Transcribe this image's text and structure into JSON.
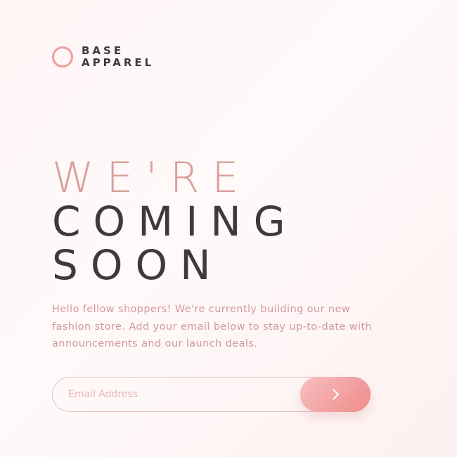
{
  "logo": {
    "line1": "BASE",
    "line2": "APPAREL",
    "mark_icon": "circle-ring-icon"
  },
  "headline": {
    "line1": "WE'RE",
    "line2": "COMING",
    "line3": "SOON"
  },
  "description": "Hello fellow shoppers! We're currently building our new fashion store. Add your email below to stay up-to-date with announcements and our launch deals.",
  "form": {
    "email_placeholder": "Email Address",
    "email_value": "",
    "submit_icon": "chevron-right-icon"
  },
  "colors": {
    "accent": "#f19c9c",
    "headline_light": "#d89b95",
    "headline_dark": "#3f3a3a",
    "body_text": "#d4979c",
    "button_gradient_start": "#f8bfbf",
    "button_gradient_end": "#ee8b8b",
    "background": "#fff6f6"
  }
}
